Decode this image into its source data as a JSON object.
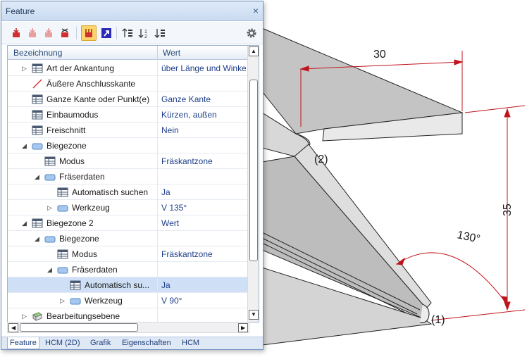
{
  "panel": {
    "title": "Feature",
    "close_glyph": "×",
    "toolbar": [
      {
        "icon": "feature-insert-icon"
      },
      {
        "icon": "feature-insert-disabled-icon"
      },
      {
        "icon": "feature-insert-disabled-icon"
      },
      {
        "icon": "feature-delete-icon"
      },
      {
        "icon": "feature-active-icon",
        "active": true
      },
      {
        "icon": "select-arrow-icon"
      },
      {
        "icon": "sort-up-icon"
      },
      {
        "icon": "sort-number-icon"
      },
      {
        "icon": "sort-list-icon"
      },
      {
        "icon": "gear-icon"
      }
    ],
    "columns": {
      "name": "Bezeichnung",
      "value": "Wert"
    },
    "rows": [
      {
        "expander": "right",
        "icon": "table",
        "label": "Art der Ankantung",
        "value": "über Länge und Winke"
      },
      {
        "expander": "",
        "icon": "line",
        "label": "Äußere Anschlusskante",
        "value": ""
      },
      {
        "expander": "",
        "icon": "table",
        "label": "Ganze Kante oder Punkt(e)",
        "value": "Ganze Kante"
      },
      {
        "expander": "",
        "icon": "table",
        "label": "Einbaumodus",
        "value": "Kürzen, außen"
      },
      {
        "expander": "",
        "icon": "table",
        "label": "Freischnitt",
        "value": "Nein"
      },
      {
        "expander": "down",
        "icon": "folder",
        "label": "Biegezone",
        "value": ""
      },
      {
        "expander": "",
        "icon": "table",
        "label": "Modus",
        "value": "Fräskantzone"
      },
      {
        "expander": "down",
        "icon": "folder",
        "label": "Fräserdaten",
        "value": ""
      },
      {
        "expander": "",
        "icon": "table",
        "label": "Automatisch suchen",
        "value": "Ja"
      },
      {
        "expander": "right",
        "icon": "folder",
        "label": "Werkzeug",
        "value": "V 135°"
      },
      {
        "expander": "down",
        "icon": "table",
        "label": "Biegezone 2",
        "value": "Wert"
      },
      {
        "expander": "down",
        "icon": "folder",
        "label": "Biegezone",
        "value": ""
      },
      {
        "expander": "",
        "icon": "table",
        "label": "Modus",
        "value": "Fräskantzone"
      },
      {
        "expander": "down",
        "icon": "folder",
        "label": "Fräserdaten",
        "value": ""
      },
      {
        "expander": "",
        "icon": "table",
        "label": "Automatisch su...",
        "value": "Ja",
        "selected": true
      },
      {
        "expander": "right",
        "icon": "folder",
        "label": "Werkzeug",
        "value": "V 90°"
      },
      {
        "expander": "right",
        "icon": "plane",
        "label": "Bearbeitungsebene",
        "value": ""
      }
    ],
    "tabs": [
      "Feature",
      "HCM (2D)",
      "Grafik",
      "Eigenschaften",
      "HCM"
    ],
    "active_tab": "Feature"
  },
  "drawing": {
    "dim_width": "30",
    "dim_height": "35",
    "dim_angle": "130°",
    "label_1": "(1)",
    "label_2": "(2)"
  },
  "colors": {
    "accent": "#ffd36b",
    "value_text": "#1f3f8a",
    "dimension_red": "#c0141c",
    "title_bar": "#c9dbf1"
  }
}
